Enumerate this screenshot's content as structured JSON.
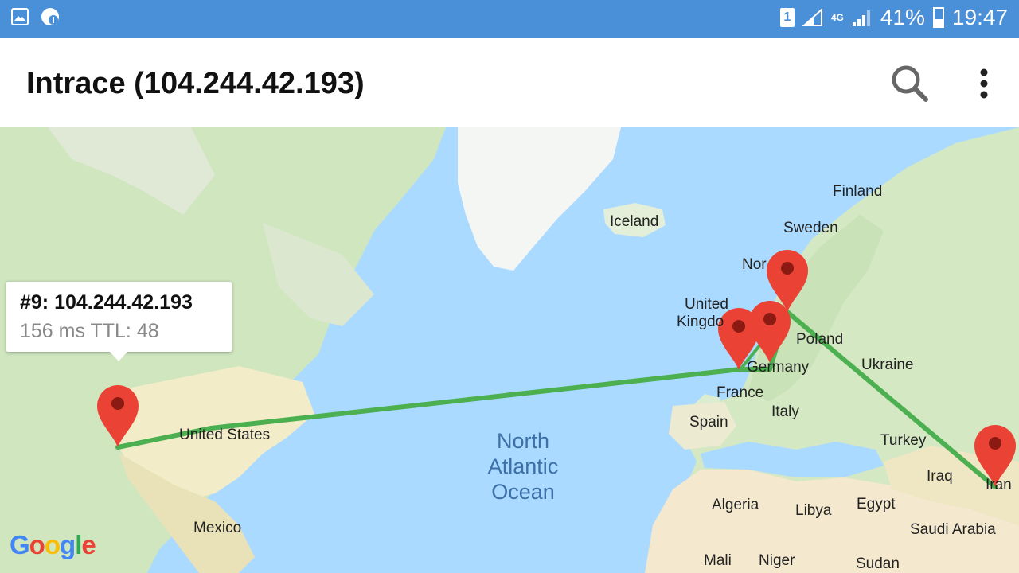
{
  "status_bar": {
    "battery_percent": "41%",
    "battery_level": 0.41,
    "time": "19:47",
    "sim_label": "1",
    "network_type": "4G",
    "left_icons": [
      "gallery-icon",
      "alert-icon"
    ]
  },
  "app_bar": {
    "title": "Intrace (104.244.42.193)",
    "actions": [
      "search-icon",
      "more-vert-icon"
    ]
  },
  "map": {
    "provider_logo": "Google",
    "labels": {
      "finland": "Finland",
      "sweden": "Sweden",
      "norway": "Nor",
      "iceland": "Iceland",
      "uk_1": "United",
      "uk_2": "Kingdo",
      "poland": "Poland",
      "germany": "Germany",
      "ukraine": "Ukraine",
      "france": "France",
      "italy": "Italy",
      "spain": "Spain",
      "turkey": "Turkey",
      "iraq": "Iraq",
      "iran": "Iran",
      "algeria": "Algeria",
      "libya": "Libya",
      "egypt": "Egypt",
      "saudi": "Saudi Arabia",
      "mali": "Mali",
      "niger": "Niger",
      "sudan": "Sudan",
      "usa": "United States",
      "mexico": "Mexico",
      "ocean_1": "North",
      "ocean_2": "Atlantic",
      "ocean_3": "Ocean"
    },
    "info_window": {
      "hop": "#9: 104.244.42.193",
      "details": "156 ms TTL: 48"
    },
    "route_color": "#4caf50",
    "marker_color": "#ea4335"
  }
}
